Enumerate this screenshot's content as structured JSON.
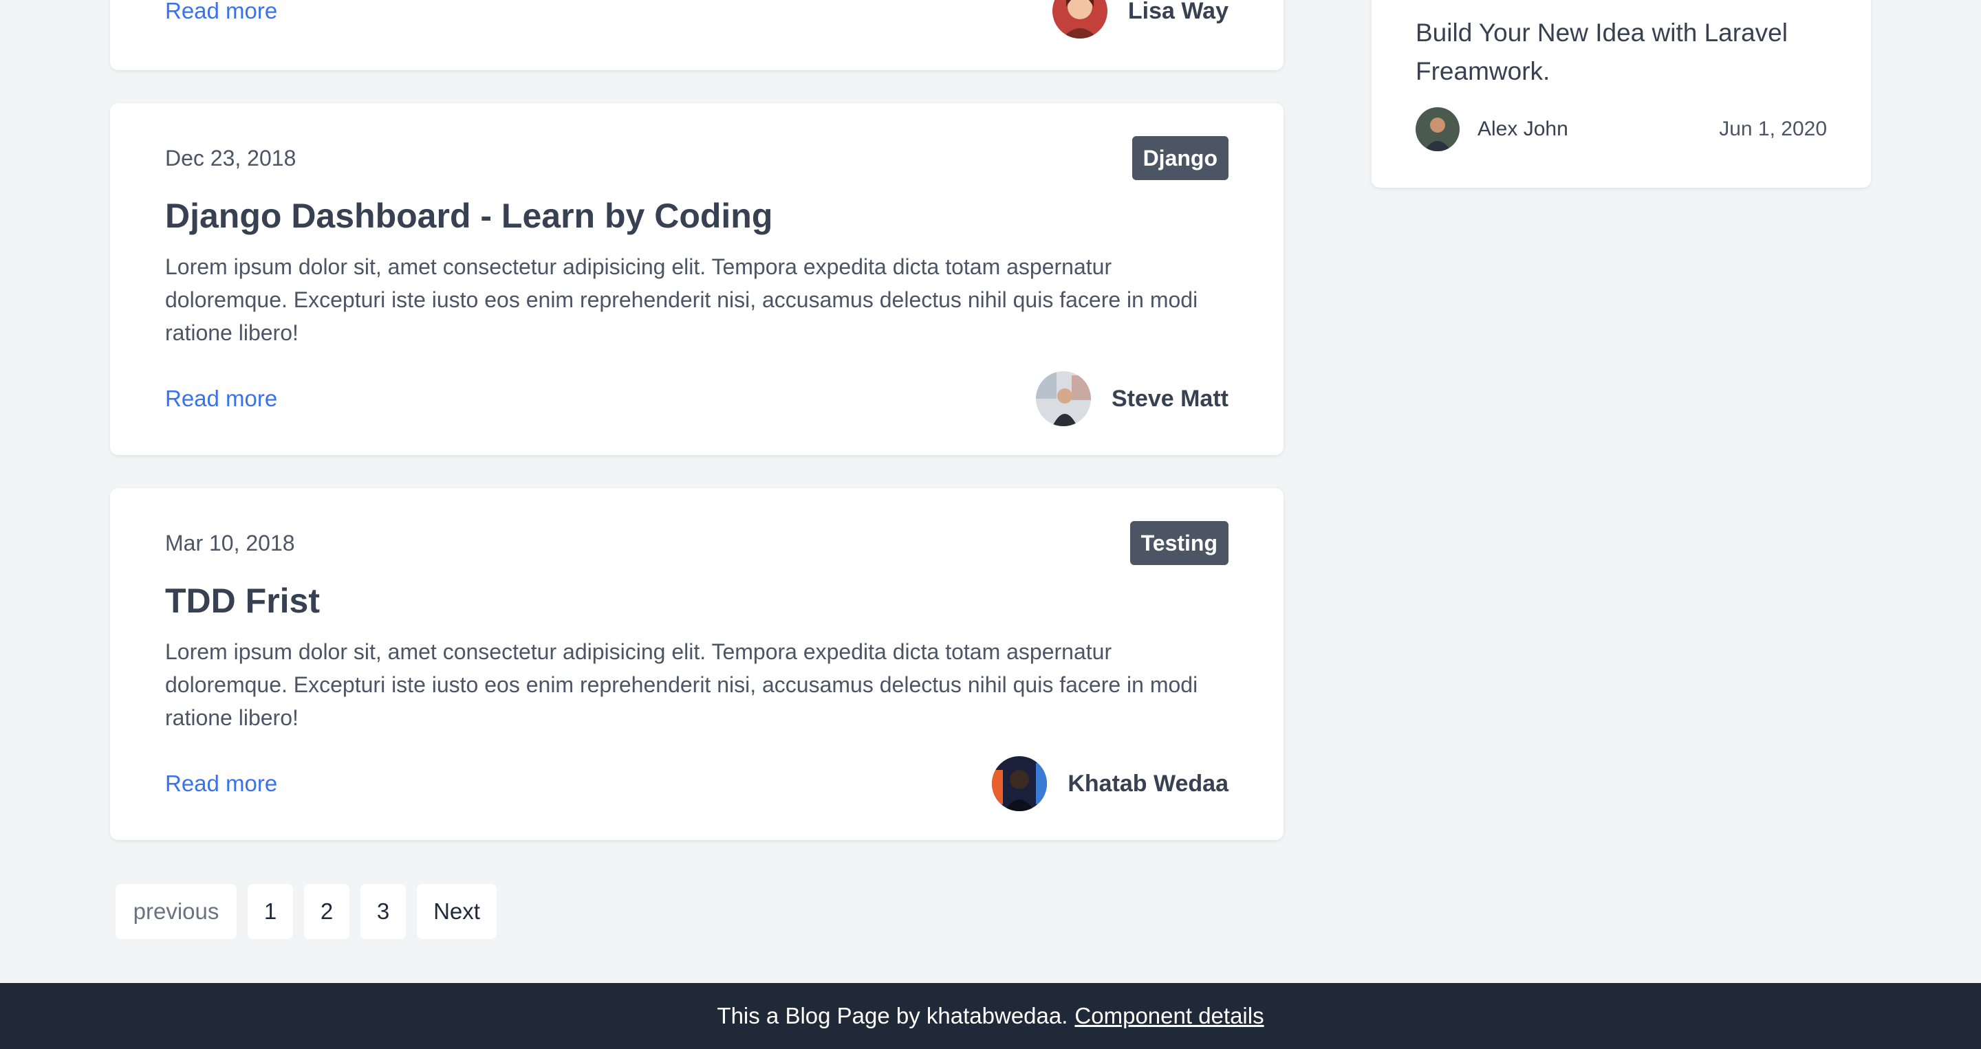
{
  "posts": [
    {
      "date": "",
      "tag": "",
      "title": "",
      "excerpt": "",
      "read_more": "Read more",
      "author": "Lisa Way"
    },
    {
      "date": "Dec 23, 2018",
      "tag": "Django",
      "title": "Django Dashboard - Learn by Coding",
      "excerpt": "Lorem ipsum dolor sit, amet consectetur adipisicing elit. Tempora expedita dicta totam aspernatur doloremque. Excepturi iste iusto eos enim reprehenderit nisi, accusamus delectus nihil quis facere in modi ratione libero!",
      "read_more": "Read more",
      "author": "Steve Matt"
    },
    {
      "date": "Mar 10, 2018",
      "tag": "Testing",
      "title": "TDD Frist",
      "excerpt": "Lorem ipsum dolor sit, amet consectetur adipisicing elit. Tempora expedita dicta totam aspernatur doloremque. Excepturi iste iusto eos enim reprehenderit nisi, accusamus delectus nihil quis facere in modi ratione libero!",
      "read_more": "Read more",
      "author": "Khatab Wedaa"
    }
  ],
  "sidebar": {
    "post_title": "Build Your New Idea with Laravel Freamwork.",
    "author": "Alex John",
    "date": "Jun 1, 2020"
  },
  "pagination": {
    "previous": "previous",
    "pages": [
      "1",
      "2",
      "3"
    ],
    "next": "Next"
  },
  "footer": {
    "text": "This a Blog Page by khatabwedaa.",
    "link": "Component details"
  },
  "colors": {
    "background": "#f3f4f6",
    "link": "#2563eb",
    "badge": "#4b5563",
    "footer": "#1f2937"
  }
}
